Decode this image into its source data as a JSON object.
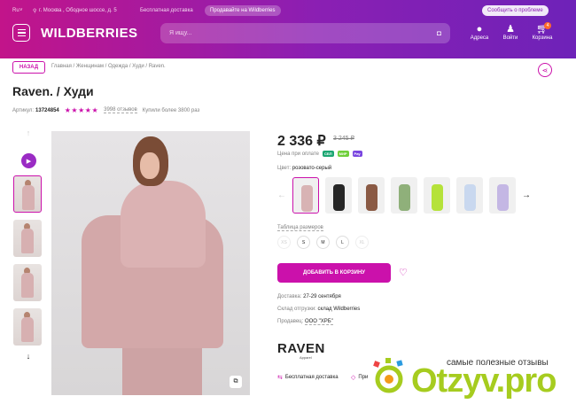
{
  "header": {
    "lang": "Ru",
    "location": "г. Москва , Ободное шоссе, д. 5",
    "free_delivery": "Бесплатная доставка",
    "sell_on": "Продавайте на Wildberries",
    "report": "Сообщить о проблеме",
    "logo": "WILDBERRIES",
    "search_placeholder": "Я ищу...",
    "address": "Адреса",
    "login": "Войти",
    "cart": "Корзина",
    "cart_count": "4"
  },
  "breadcrumb": {
    "back": "НАЗАД",
    "path": "Главная  /  Женщинам  /  Одежда  /  Худи  /  Raven."
  },
  "product": {
    "title": "Raven. / Худи",
    "article_label": "Артикул:",
    "article": "13724854",
    "stars": "★★★★★",
    "reviews": "3998 отзывов",
    "bought": "Купили более 3800 раз",
    "price": "2 336 ₽",
    "old_price": "3 245 ₽",
    "pay_label": "Цена при оплате",
    "color_label": "Цвет:",
    "color_value": "розовато-серый",
    "size_table": "Таблица размеров",
    "sizes": [
      "XS",
      "S",
      "M",
      "L",
      "XL"
    ],
    "add_to_cart": "ДОБАВИТЬ В КОРЗИНУ",
    "delivery_label": "Доставка:",
    "delivery_value": "27-29 сентября",
    "warehouse_label": "Склад отгрузки:",
    "warehouse_value": "склад Wildberries",
    "seller_label": "Продавец:",
    "seller_value": "ООО \"ХРБ\"",
    "brand": "RAVEN",
    "brand_sub": "Apparel",
    "feature1": "Бесплатная доставка",
    "feature2": "При"
  },
  "watermark": {
    "site": "Otzyv.pro",
    "slogan": "самые полезные отзывы"
  },
  "colors": {
    "accent": "#cb11ab",
    "header_start": "#c2148a",
    "header_end": "#6e22b8",
    "watermark": "#a6cc1f"
  },
  "swatch_colors": [
    "#d8b3b4",
    "#262626",
    "#8a5a44",
    "#8fb07a",
    "#b5e23a",
    "#c9d8ef",
    "#c4b7e4"
  ]
}
